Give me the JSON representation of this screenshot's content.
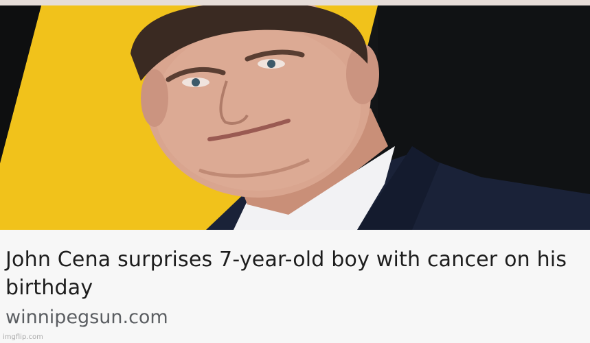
{
  "article": {
    "headline": "John Cena surprises 7-year-old boy with cancer on his birthday",
    "source": "winnipegsun.com"
  },
  "photo": {
    "background_colors": {
      "yellow": "#f1c21b",
      "dark": "#131517",
      "suit": "#1a2238",
      "shirt": "#f2f2f4",
      "skin": "#d9a58f",
      "hair": "#3a2a22"
    }
  },
  "watermark": "imgflip.com"
}
